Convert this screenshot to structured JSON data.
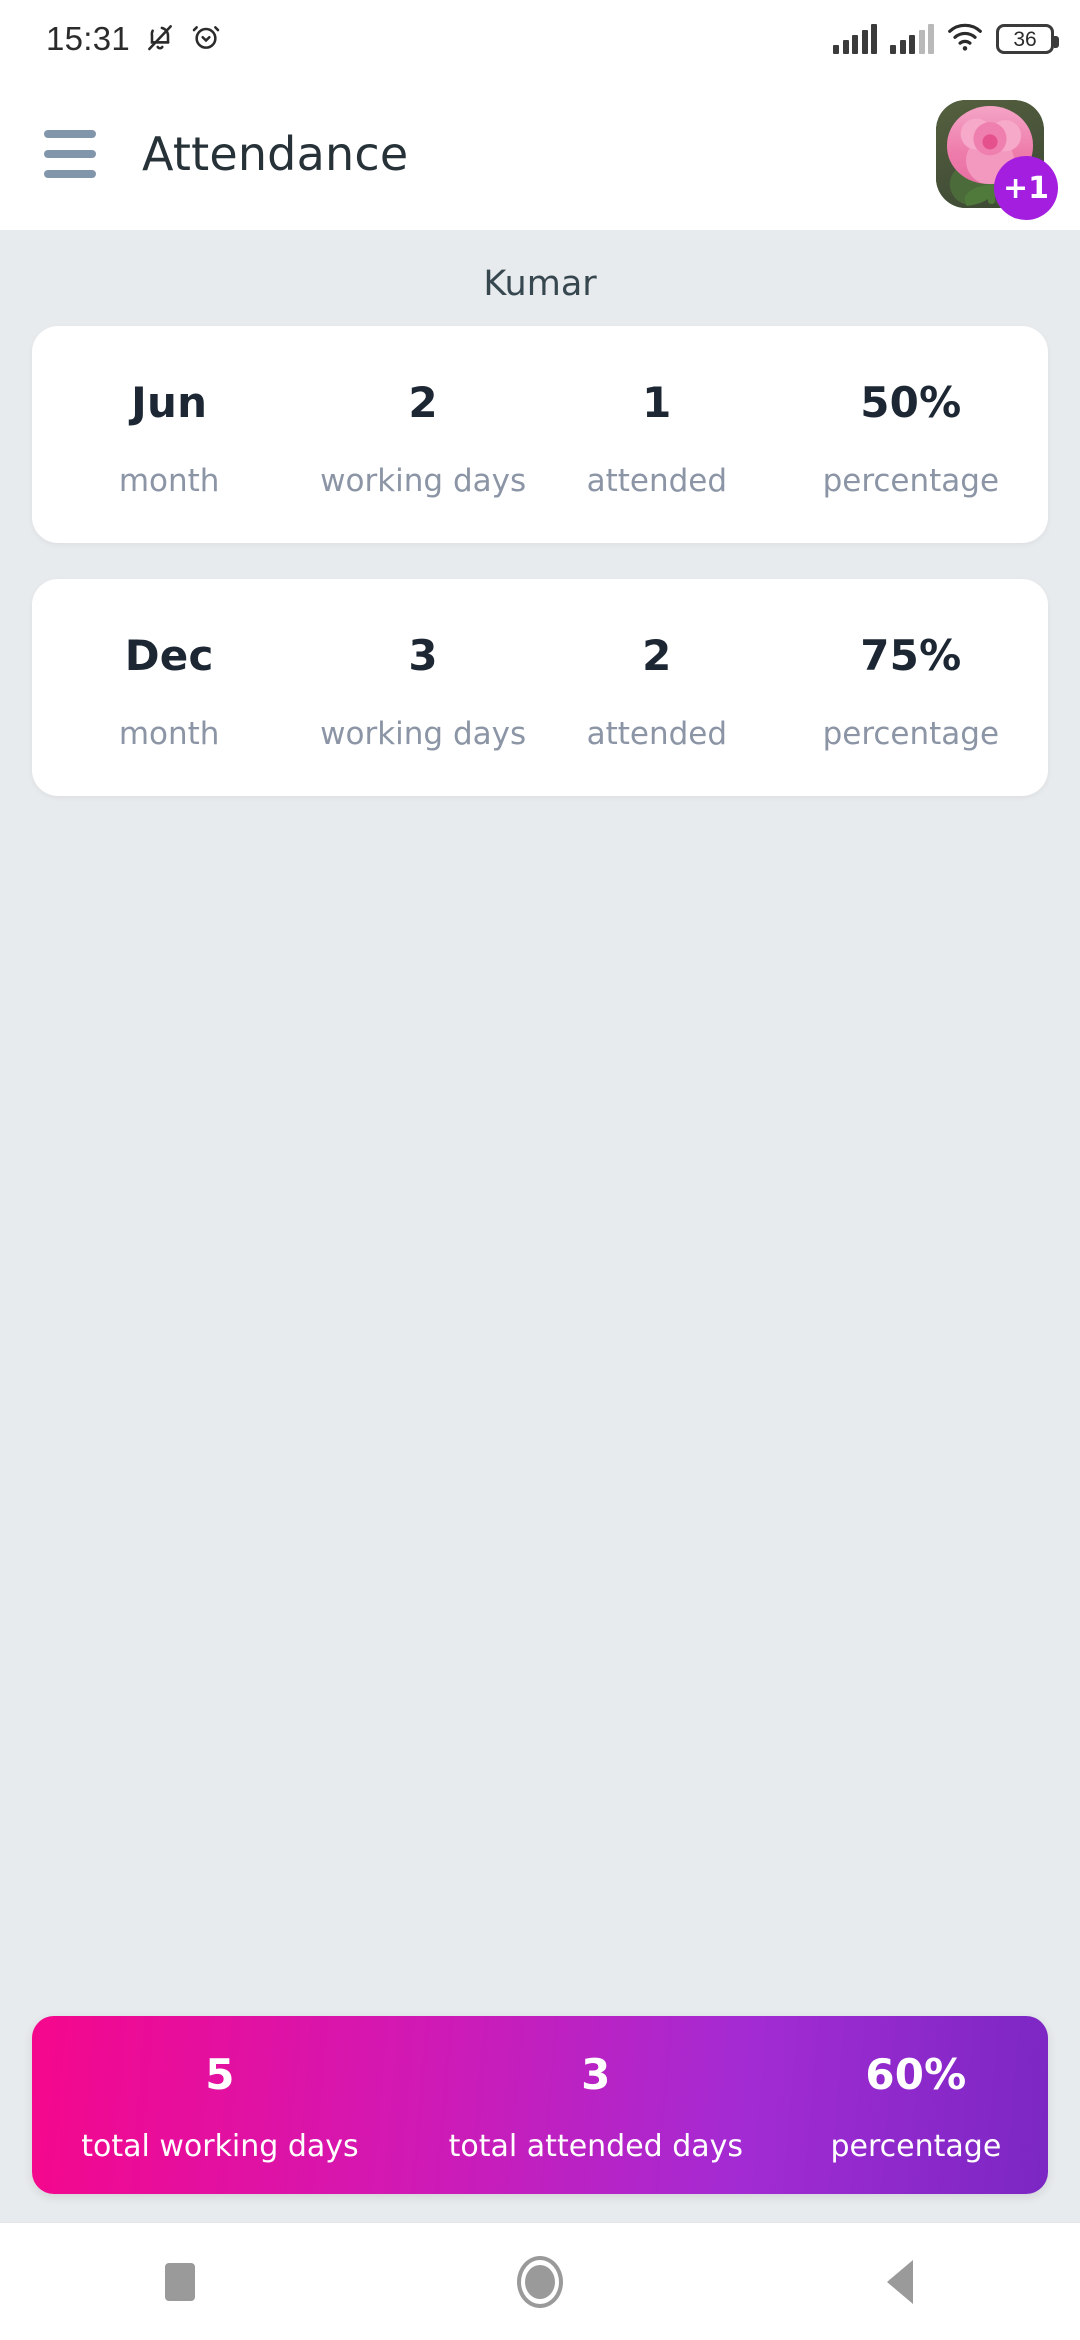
{
  "status_bar": {
    "time": "15:31",
    "icons": [
      "bell-muted-icon",
      "alarm-icon",
      "signal-bars-icon",
      "signal-bars-secondary-icon",
      "wifi-icon",
      "battery-icon"
    ],
    "battery_level": "36"
  },
  "app_bar": {
    "menu_icon": "hamburger-menu-icon",
    "title": "Attendance",
    "avatar_icon": "user-avatar-rose-photo",
    "badge": "+1"
  },
  "content": {
    "student_name": "Kumar",
    "column_labels": {
      "month": "month",
      "working_days": "working days",
      "attended": "attended",
      "percentage": "percentage"
    },
    "records": [
      {
        "month": "Jun",
        "working_days": "2",
        "attended": "1",
        "percentage": "50%"
      },
      {
        "month": "Dec",
        "working_days": "3",
        "attended": "2",
        "percentage": "75%"
      }
    ]
  },
  "totals": {
    "working_days_value": "5",
    "working_days_label": "total working days",
    "attended_value": "3",
    "attended_label": "total attended days",
    "percentage_value": "60%",
    "percentage_label": "percentage",
    "gradient_start": "#f5078c",
    "gradient_end": "#7b27c4"
  },
  "nav_bar": {
    "recents": "recents-square-icon",
    "home": "home-circle-icon",
    "back": "back-triangle-icon"
  },
  "theme": {
    "background": "#e8ebee",
    "card_background": "#ffffff",
    "accent_badge": "#a41ee0",
    "value_text": "#1d2733",
    "label_text": "#8b95a5"
  }
}
